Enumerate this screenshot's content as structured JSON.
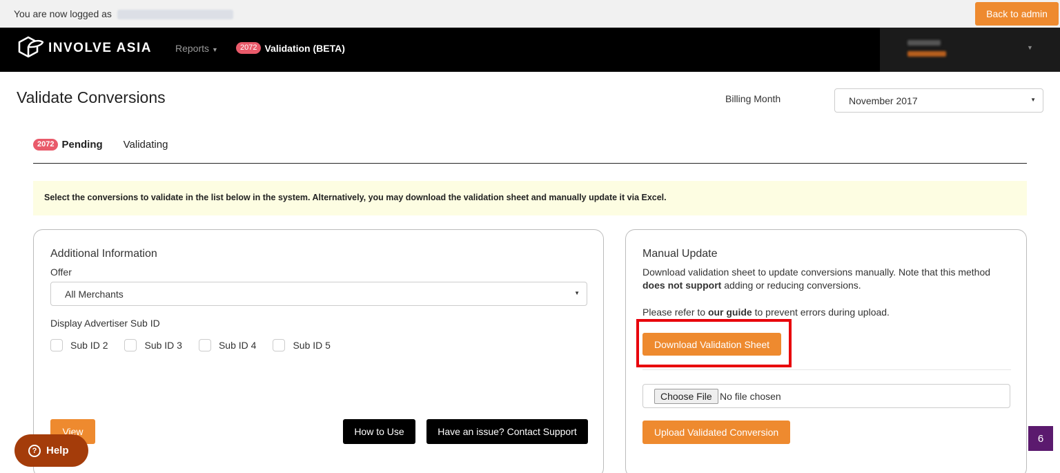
{
  "impersonation": {
    "text": "You are now logged as",
    "back_label": "Back to admin"
  },
  "navbar": {
    "brand": "INVOLVE ASIA",
    "reports_label": "Reports",
    "validation_badge": "2072",
    "validation_label": "Validation (BETA)"
  },
  "page": {
    "title": "Validate Conversions",
    "billing_label": "Billing Month",
    "billing_value": "November 2017"
  },
  "tabs": {
    "pending_badge": "2072",
    "pending_label": "Pending",
    "validating_label": "Validating"
  },
  "notice": "Select the conversions to validate in the list below in the system. Alternatively, you may download the validation sheet and manually update it via Excel.",
  "additional": {
    "title": "Additional Information",
    "offer_label": "Offer",
    "offer_value": "All Merchants",
    "sub_label": "Display Advertiser Sub ID",
    "sub_ids": [
      "Sub ID 2",
      "Sub ID 3",
      "Sub ID 4",
      "Sub ID 5"
    ],
    "view_label": "View",
    "how_label": "How to Use",
    "contact_label": "Have an issue? Contact Support"
  },
  "manual": {
    "title": "Manual Update",
    "desc_1": "Download validation sheet to update conversions manually. Note that this method ",
    "desc_bold": "does not support",
    "desc_2": " adding or reducing conversions.",
    "guide_1": "Please refer to ",
    "guide_bold": "our guide",
    "guide_2": " to prevent errors during upload.",
    "download_label": "Download Validation Sheet",
    "choose_label": "Choose File",
    "no_file": "No file chosen",
    "upload_label": "Upload Validated Conversion"
  },
  "help_label": "Help",
  "side_badge": "6",
  "colors": {
    "accent": "#ee8a2f",
    "badge": "#e95a6a",
    "highlight": "#e8000b",
    "help": "#a43c0a",
    "notice_bg": "#fdfde2"
  }
}
